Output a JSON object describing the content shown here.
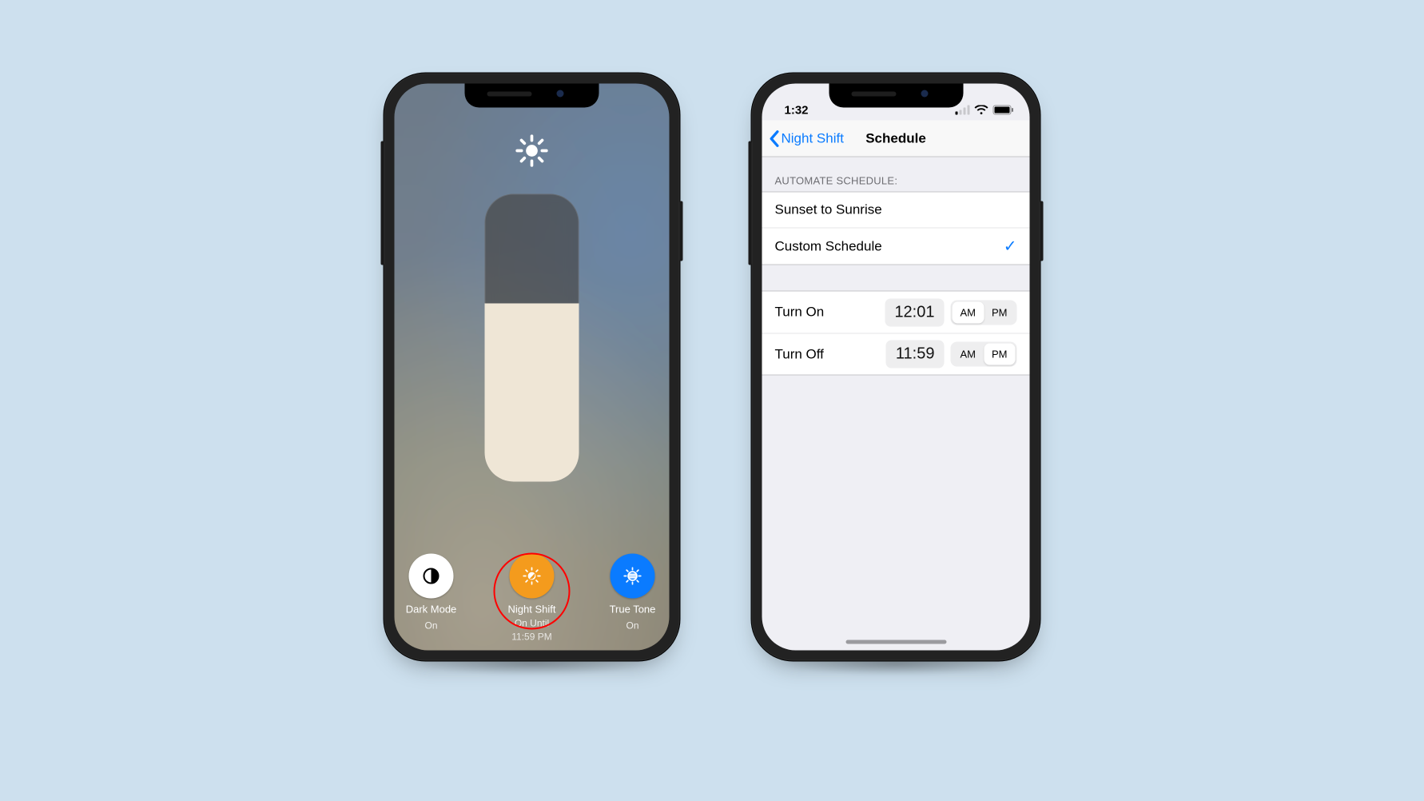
{
  "left_phone": {
    "brightness_pct": 62,
    "buttons": {
      "dark_mode": {
        "label": "Dark Mode",
        "status": "On"
      },
      "night_shift": {
        "label": "Night Shift",
        "status_line1": "On Until",
        "status_line2": "11:59 PM"
      },
      "true_tone": {
        "label": "True Tone",
        "status": "On"
      }
    }
  },
  "right_phone": {
    "status_time": "1:32",
    "nav_back": "Night Shift",
    "nav_title": "Schedule",
    "section_header": "Automate Schedule:",
    "options": {
      "sunset": "Sunset to Sunrise",
      "custom": "Custom Schedule"
    },
    "selected": "custom",
    "turn_on": {
      "label": "Turn On",
      "time": "12:01",
      "ampm": "AM"
    },
    "turn_off": {
      "label": "Turn Off",
      "time": "11:59",
      "ampm": "PM"
    }
  }
}
